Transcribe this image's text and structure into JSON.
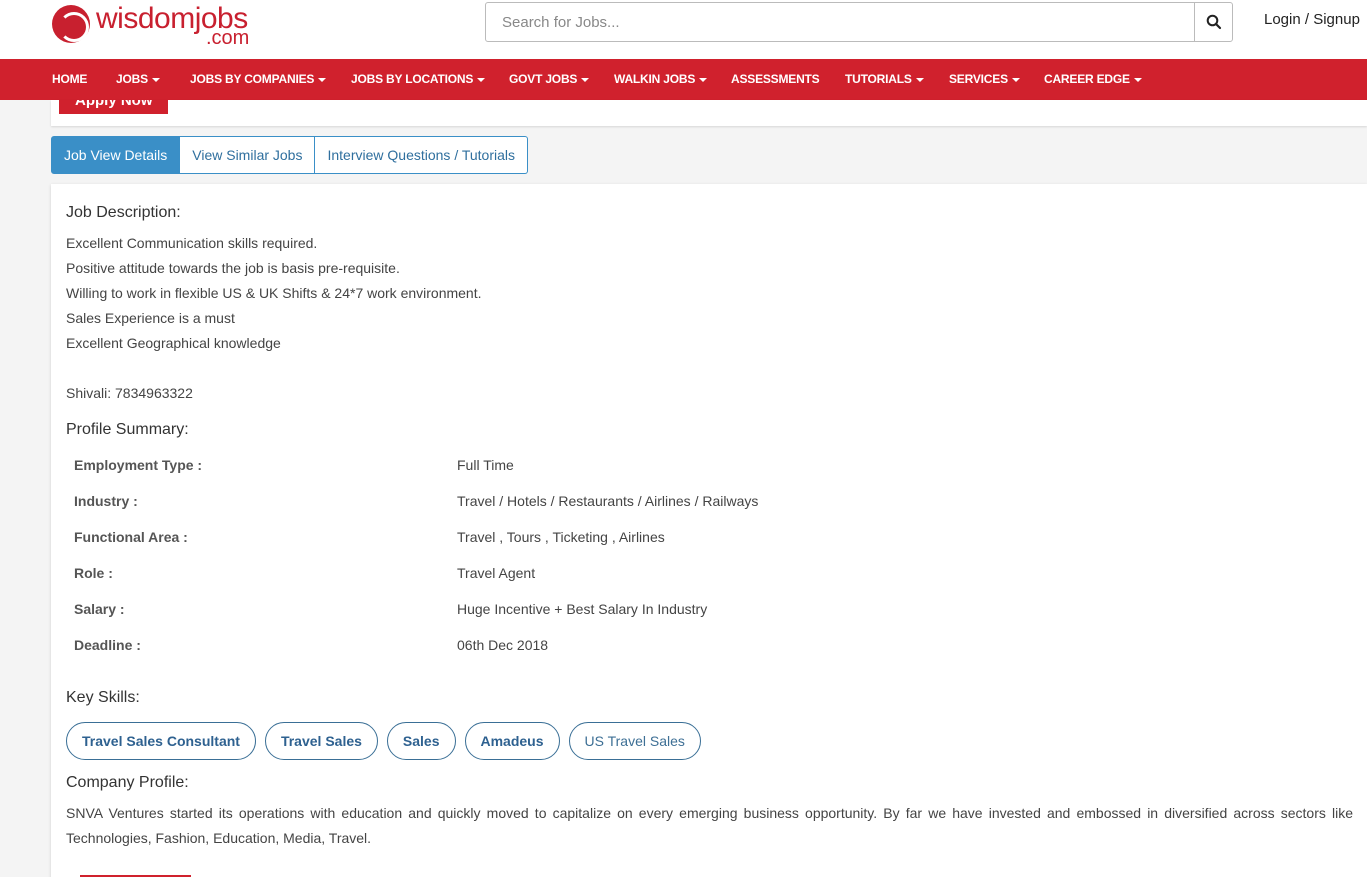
{
  "header": {
    "logo_text": "wisdomjobs",
    "logo_suffix": ".com",
    "search_placeholder": "Search for Jobs...",
    "login_label": "Login / Signup"
  },
  "nav": {
    "items": [
      {
        "label": "HOME",
        "dropdown": false
      },
      {
        "label": "JOBS",
        "dropdown": true
      },
      {
        "label": "JOBS BY COMPANIES",
        "dropdown": true
      },
      {
        "label": "JOBS BY LOCATIONS",
        "dropdown": true
      },
      {
        "label": "GOVT JOBS",
        "dropdown": true
      },
      {
        "label": "WALKIN JOBS",
        "dropdown": true
      },
      {
        "label": "ASSESSMENTS",
        "dropdown": false
      },
      {
        "label": "TUTORIALS",
        "dropdown": true
      },
      {
        "label": "SERVICES",
        "dropdown": true
      },
      {
        "label": "CAREER EDGE",
        "dropdown": true
      }
    ]
  },
  "top_card": {
    "apply_label": "Apply Now"
  },
  "tabs": [
    {
      "label": "Job View Details",
      "active": true
    },
    {
      "label": "View Similar Jobs",
      "active": false
    },
    {
      "label": "Interview Questions / Tutorials",
      "active": false
    }
  ],
  "job_description": {
    "title": "Job Description:",
    "lines": [
      "Excellent Communication skills required.",
      "Positive attitude towards the job is basis pre-requisite.",
      "Willing to work in flexible US & UK Shifts & 24*7 work environment.",
      "Sales Experience is a must",
      "Excellent Geographical knowledge"
    ],
    "contact": "Shivali: 7834963322"
  },
  "profile_summary": {
    "title": "Profile Summary:",
    "rows": [
      {
        "label": "Employment Type :",
        "value": "Full Time"
      },
      {
        "label": "Industry :",
        "value": "Travel / Hotels / Restaurants / Airlines / Railways"
      },
      {
        "label": "Functional Area :",
        "value": "Travel , Tours , Ticketing , Airlines"
      },
      {
        "label": "Role :",
        "value": "Travel Agent"
      },
      {
        "label": "Salary :",
        "value": "Huge Incentive + Best Salary In Industry"
      },
      {
        "label": "Deadline :",
        "value": "06th Dec 2018"
      }
    ]
  },
  "key_skills": {
    "title": "Key Skills:",
    "skills": [
      "Travel Sales Consultant",
      "Travel Sales",
      "Sales",
      "Amadeus",
      "US Travel Sales"
    ]
  },
  "company_profile": {
    "title": "Company Profile:",
    "text": "SNVA Ventures started its operations with education and quickly moved to capitalize on every emerging business opportunity. By far we have invested and embossed in diversified across sectors like Technologies, Fashion, Education, Media, Travel."
  },
  "colors": {
    "brand_red": "#d0212d",
    "tab_blue": "#3a8fc7",
    "skill_blue": "#2e6190"
  },
  "icons": {
    "search": "search-icon",
    "caret": "caret-down-icon",
    "logo": "wisdomjobs-logo-icon"
  }
}
